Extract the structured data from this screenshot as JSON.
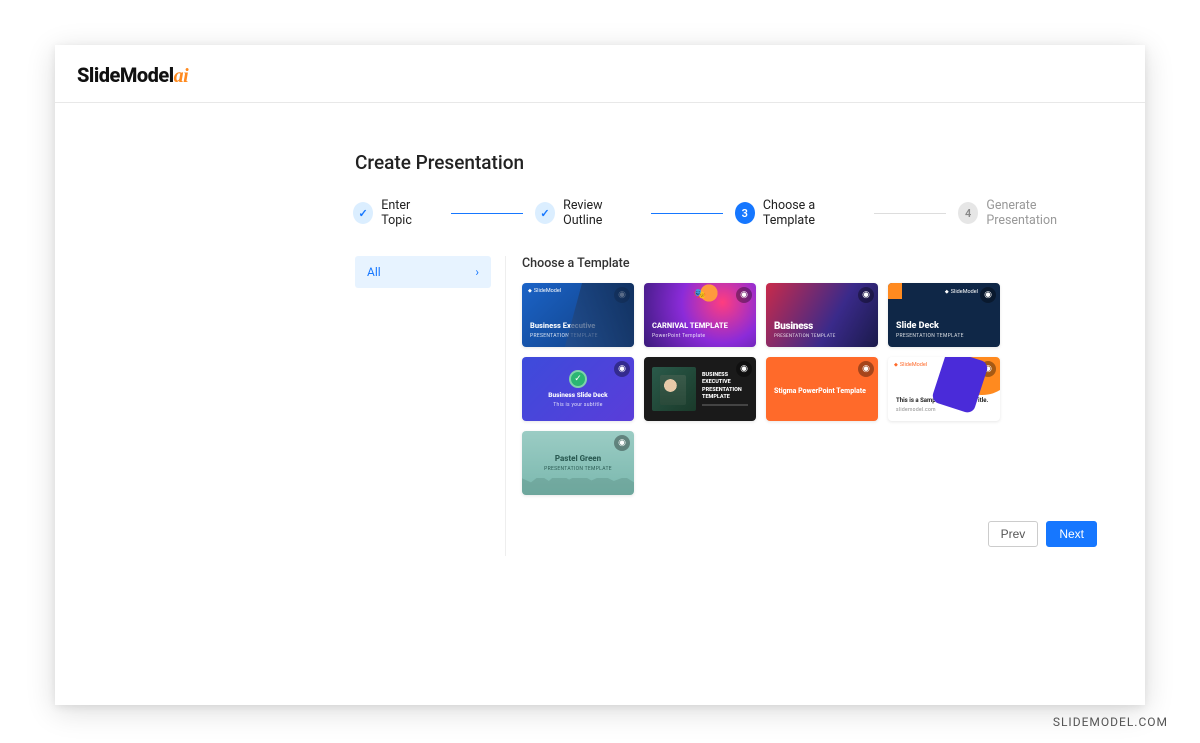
{
  "brand": {
    "name": "SlideModel",
    "suffix": "ai"
  },
  "page_title": "Create Presentation",
  "stepper": {
    "steps": [
      {
        "label": "Enter Topic",
        "state": "done"
      },
      {
        "label": "Review Outline",
        "state": "done"
      },
      {
        "label": "Choose a Template",
        "state": "active",
        "num": "3"
      },
      {
        "label": "Generate Presentation",
        "state": "pending",
        "num": "4"
      }
    ]
  },
  "sidebar": {
    "items": [
      {
        "label": "All"
      }
    ]
  },
  "section_title": "Choose a Template",
  "templates": [
    {
      "title": "Business Executive",
      "subtitle": "PRESENTATION TEMPLATE",
      "logo": "SlideModel"
    },
    {
      "title": "CARNIVAL TEMPLATE",
      "subtitle": "PowerPoint Template",
      "logo": ""
    },
    {
      "title": "Business",
      "subtitle": "PRESENTATION TEMPLATE",
      "logo": ""
    },
    {
      "title": "Slide Deck",
      "subtitle": "PRESENTATION TEMPLATE",
      "logo": "SlideModel"
    },
    {
      "title": "Business Slide Deck",
      "subtitle": "This is your subtitle",
      "logo": ""
    },
    {
      "title": "BUSINESS EXECUTIVE PRESENTATION TEMPLATE",
      "subtitle": "",
      "logo": ""
    },
    {
      "title": "Stigma PowerPoint Template",
      "subtitle": "",
      "logo": ""
    },
    {
      "title": "This is a Sample Title. Insert Title.",
      "subtitle": "slidemodel.com",
      "logo": "SlideModel"
    },
    {
      "title": "Pastel Green",
      "subtitle": "PRESENTATION TEMPLATE",
      "logo": ""
    }
  ],
  "nav": {
    "prev": "Prev",
    "next": "Next"
  },
  "watermark": "SLIDEMODEL.COM"
}
